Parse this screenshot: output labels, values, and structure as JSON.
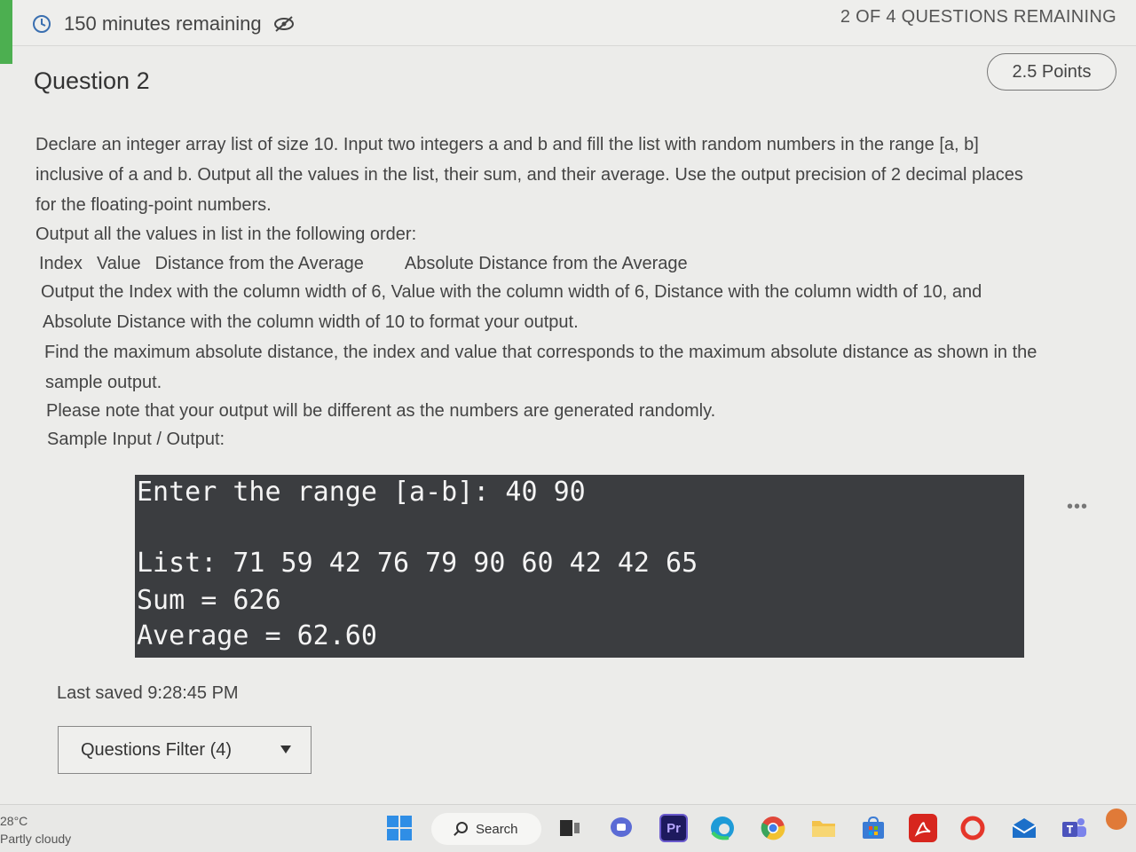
{
  "header": {
    "timer_text": "150 minutes remaining",
    "remaining_text": "2 OF 4 QUESTIONS REMAINING"
  },
  "question": {
    "title": "Question 2",
    "points": "2.5 Points",
    "lines": [
      "Declare an integer array list of size 10. Input two integers a and b and fill the list with random numbers in the range [a, b]",
      "inclusive of a and b. Output all the values in the list, their sum, and their average. Use the output precision of 2 decimal places",
      "for the floating-point numbers.",
      "Output all the values in list in the following order:",
      "Output the Index with the column width of 6, Value with the column width of 6, Distance with the column width of 10, and",
      "Absolute Distance with the column width of 10 to format your output.",
      "Find the maximum absolute distance, the index and value that corresponds to the maximum absolute distance as shown in the",
      "sample output.",
      "Please note that your output will be different as the numbers are generated randomly.",
      "Sample Input / Output:"
    ],
    "columns": [
      "Index",
      "Value",
      "Distance from the Average",
      "Absolute Distance from the Average"
    ]
  },
  "console": {
    "line1": "Enter the range [a-b]: 40 90",
    "line2": "List: 71 59 42 76 79 90 60 42 42 65",
    "line3": "Sum = 626",
    "line4": "Average = 62.60"
  },
  "more_dots": "•••",
  "footer": {
    "last_saved": "Last saved 9:28:45 PM",
    "filter_label": "Questions Filter (4)"
  },
  "taskbar": {
    "temperature": "28°C",
    "weather": "Partly cloudy",
    "search_label": "Search",
    "premiere_label": "Pr"
  },
  "colors": {
    "accent_green": "#4caf50",
    "console_bg": "#3b3d40",
    "console_text": "#f4f4f4"
  }
}
